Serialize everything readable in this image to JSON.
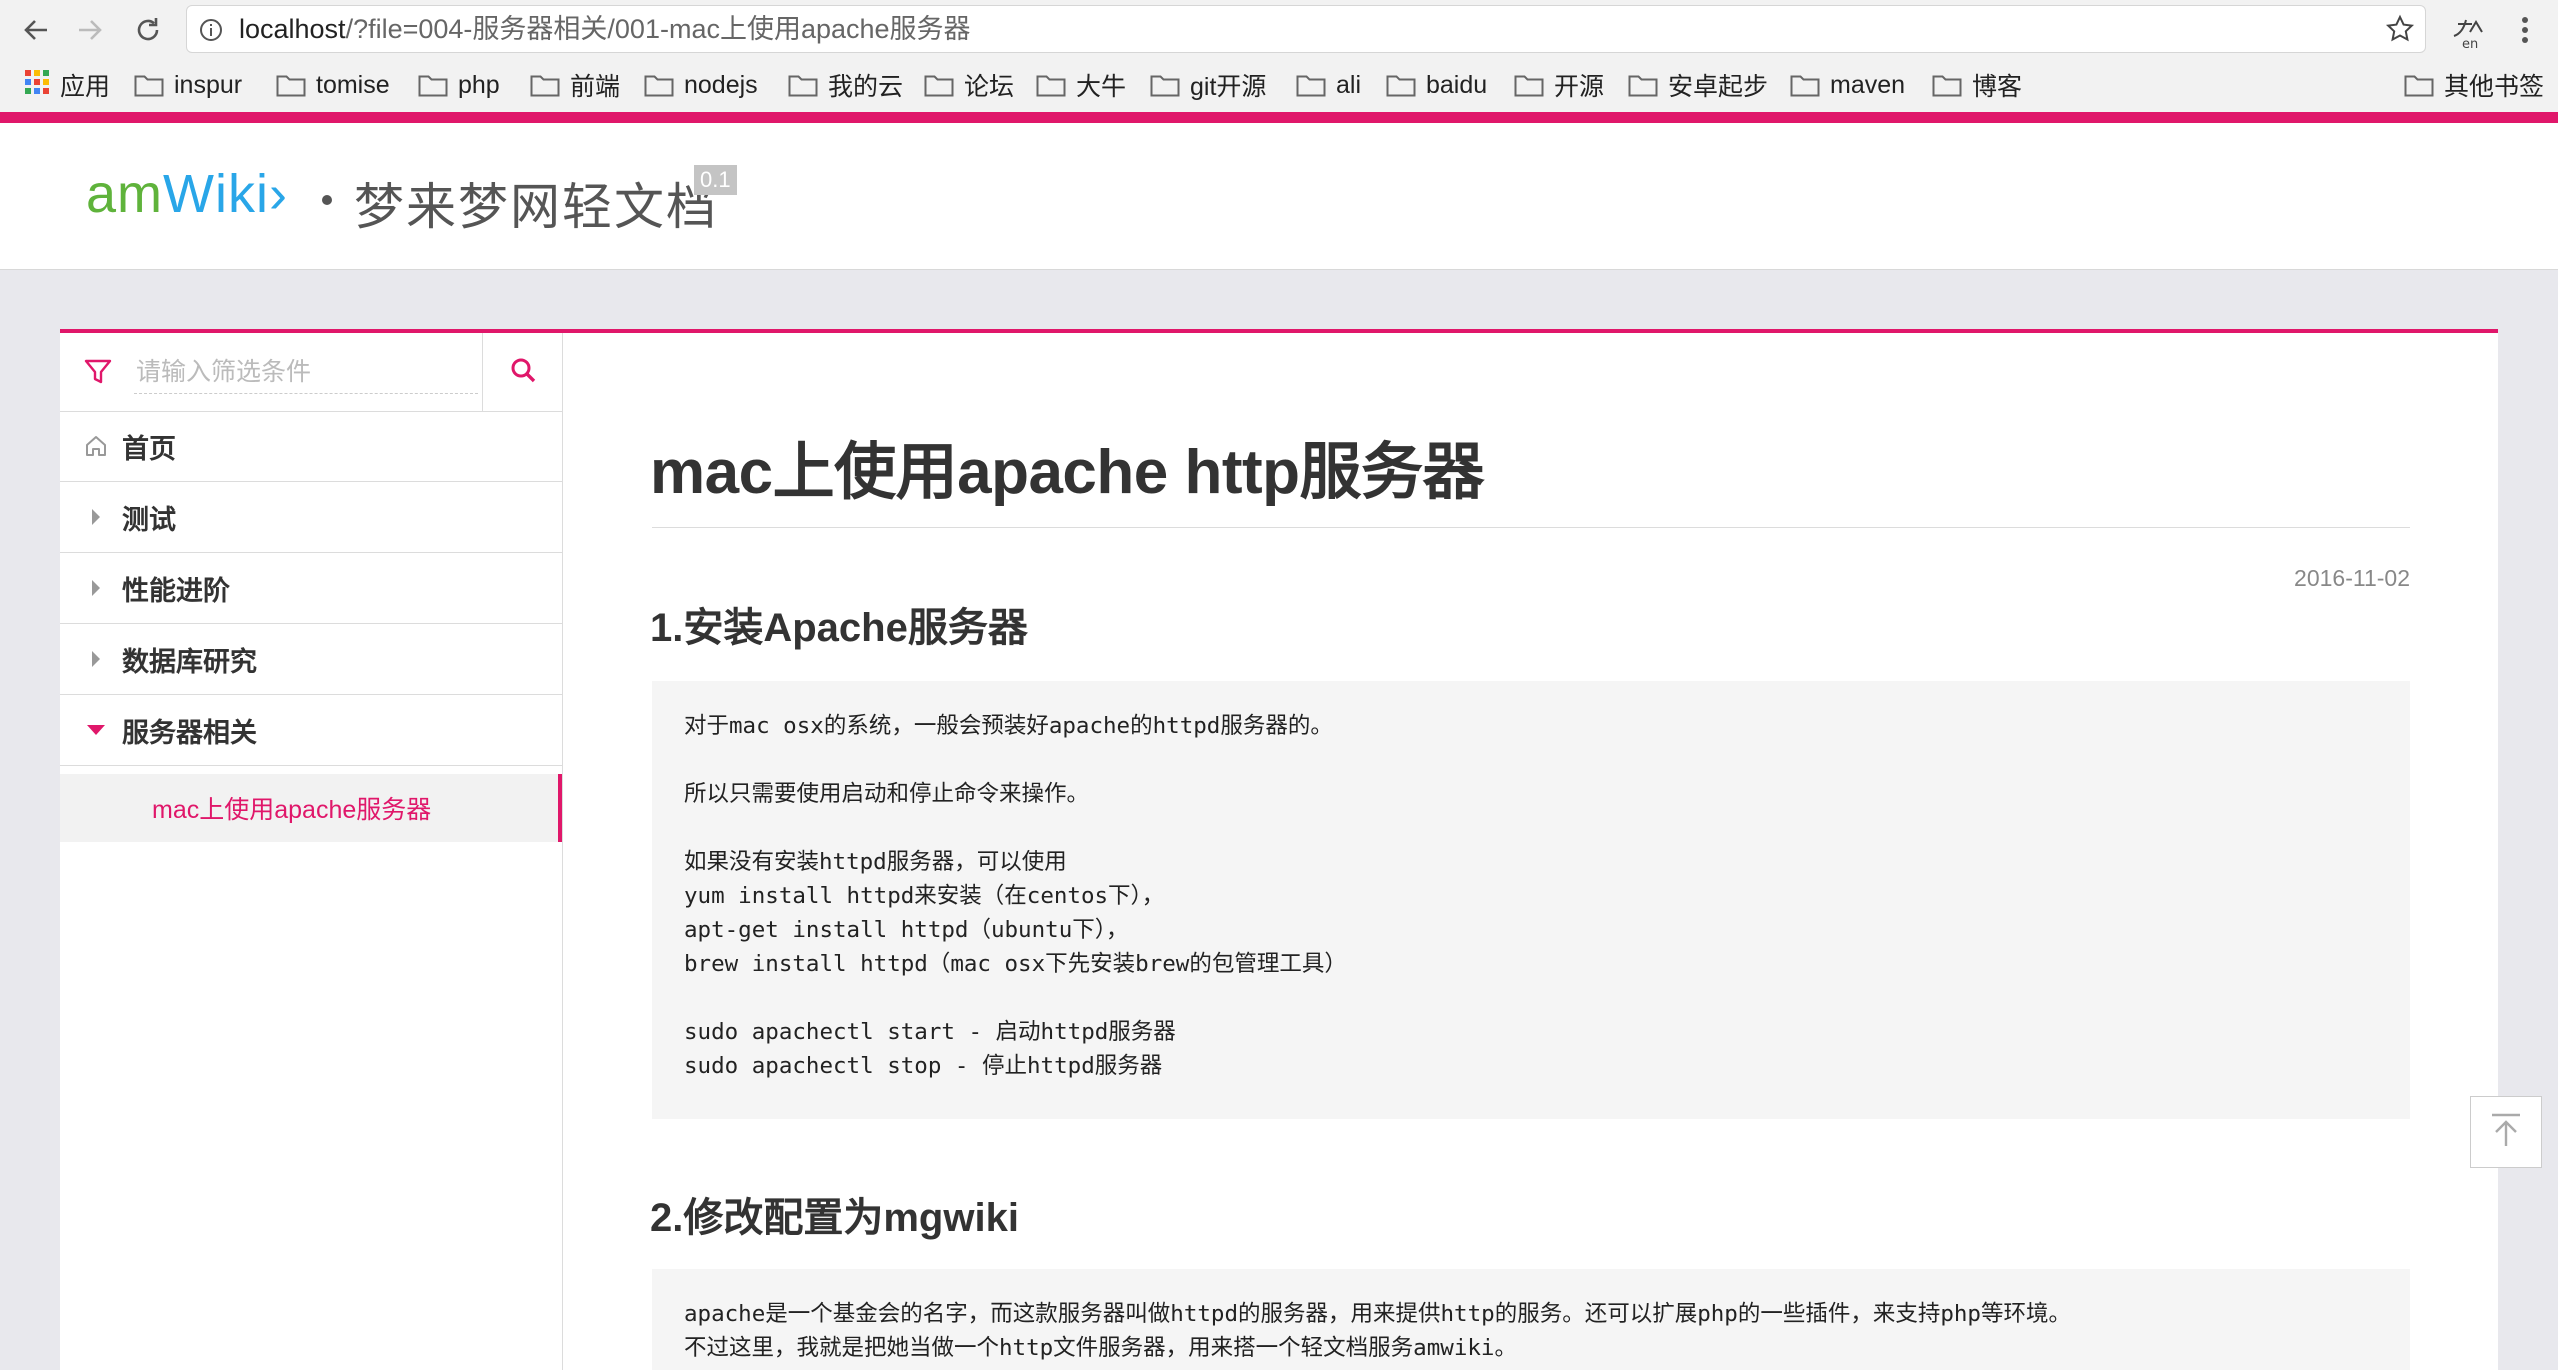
{
  "browser": {
    "url_host": "localhost",
    "url_rest": "/?file=004-服务器相关/001-mac上使用apache服务器",
    "apps_label": "应用",
    "bookmarks": [
      "inspur",
      "tomise",
      "php",
      "前端",
      "nodejs",
      "我的云",
      "论坛",
      "大牛",
      "git开源",
      "ali",
      "baidu",
      "开源",
      "安卓起步",
      "maven",
      "博客"
    ],
    "other_bookmarks": "其他书签"
  },
  "header": {
    "logo_am": "am",
    "logo_wiki": "Wiki",
    "logo_arrow": "›",
    "site_name": "梦来梦网轻文档",
    "version": "0.1",
    "accent_color": "#e0176a"
  },
  "sidebar": {
    "filter_placeholder": "请输入筛选条件",
    "items": [
      {
        "label": "首页",
        "icon": "home-icon"
      },
      {
        "label": "测试",
        "icon": "caret-right-icon"
      },
      {
        "label": "性能进阶",
        "icon": "caret-right-icon"
      },
      {
        "label": "数据库研究",
        "icon": "caret-right-icon"
      },
      {
        "label": "服务器相关",
        "icon": "caret-down-icon"
      }
    ],
    "active_sub": "mac上使用apache服务器"
  },
  "article": {
    "title": "mac上使用apache http服务器",
    "date": "2016-11-02",
    "section1_title": "1.安装Apache服务器",
    "section1_code": "对于mac osx的系统，一般会预装好apache的httpd服务器的。\n\n所以只需要使用启动和停止命令来操作。\n\n如果没有安装httpd服务器，可以使用\nyum install httpd来安装（在centos下），\napt-get install httpd（ubuntu下），\nbrew install httpd（mac osx下先安装brew的包管理工具）\n\nsudo apachectl start - 启动httpd服务器\nsudo apachectl stop - 停止httpd服务器",
    "section2_title": "2.修改配置为mgwiki",
    "section2_code": "apache是一个基金会的名字，而这款服务器叫做httpd的服务器，用来提供http的服务。还可以扩展php的一些插件，来支持php等环境。\n不过这里，我就是把她当做一个http文件服务器，用来搭一个轻文档服务amwiki。"
  }
}
